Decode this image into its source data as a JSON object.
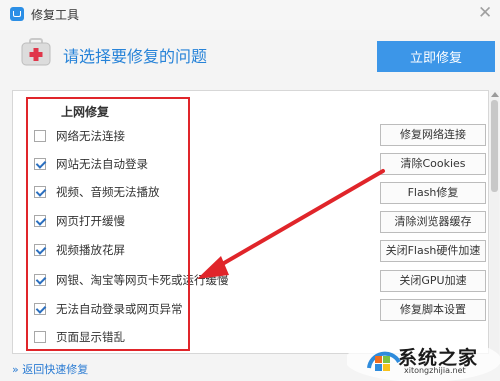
{
  "window": {
    "title": "修复工具"
  },
  "header": {
    "question": "请选择要修复的问题",
    "repair_now_label": "立即修复"
  },
  "section": {
    "title": "上网修复"
  },
  "items": [
    {
      "label": "网络无法连接",
      "checked": false
    },
    {
      "label": "网站无法自动登录",
      "checked": true
    },
    {
      "label": "视频、音频无法播放",
      "checked": true
    },
    {
      "label": "网页打开缓慢",
      "checked": true
    },
    {
      "label": "视频播放花屏",
      "checked": true
    },
    {
      "label": "网银、淘宝等网页卡死或运行缓慢",
      "checked": true
    },
    {
      "label": "无法自动登录或网页异常",
      "checked": true
    },
    {
      "label": "页面显示错乱",
      "checked": false
    }
  ],
  "fix_buttons": [
    "修复网络连接",
    "清除Cookies",
    "Flash修复",
    "清除浏览器缓存",
    "关闭Flash硬件加速",
    "关闭GPU加速",
    "修复脚本设置"
  ],
  "footer": {
    "back_label": "返回快速修复"
  },
  "watermark": {
    "brand": "系统之家",
    "url": "xitongzhijia.net"
  },
  "colors": {
    "accent": "#3c96e8",
    "annotation": "#e0252a",
    "link": "#2b7cd3"
  }
}
